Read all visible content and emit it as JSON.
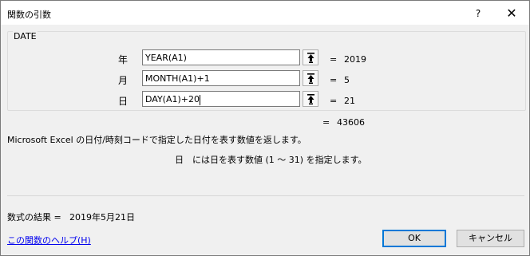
{
  "dialog": {
    "title": "関数の引数",
    "help_symbol": "?",
    "close_symbol": "✕"
  },
  "function": {
    "name": "DATE",
    "args": [
      {
        "label": "年",
        "value": "YEAR(A1)",
        "result": "2019"
      },
      {
        "label": "月",
        "value": "MONTH(A1)+1",
        "result": "5"
      },
      {
        "label": "日",
        "value": "DAY(A1)+20",
        "result": "21"
      }
    ],
    "eq": "=",
    "result": "43606",
    "description": "Microsoft Excel の日付/時刻コードで指定した日付を表す数値を返します。",
    "arg_desc_name": "日",
    "arg_desc_text": "には日を表す数値 (1 ～ 31) を指定します。"
  },
  "footer": {
    "formula_result_label": "数式の結果 =",
    "formula_result_value": "2019年5月21日",
    "help_link": "この関数のヘルプ(H)",
    "ok_label": "OK",
    "cancel_label": "キャンセル"
  },
  "icons": {
    "collapse": "collapse-dialog-icon"
  },
  "colors": {
    "accent": "#0078d7",
    "link": "#0000ee"
  }
}
